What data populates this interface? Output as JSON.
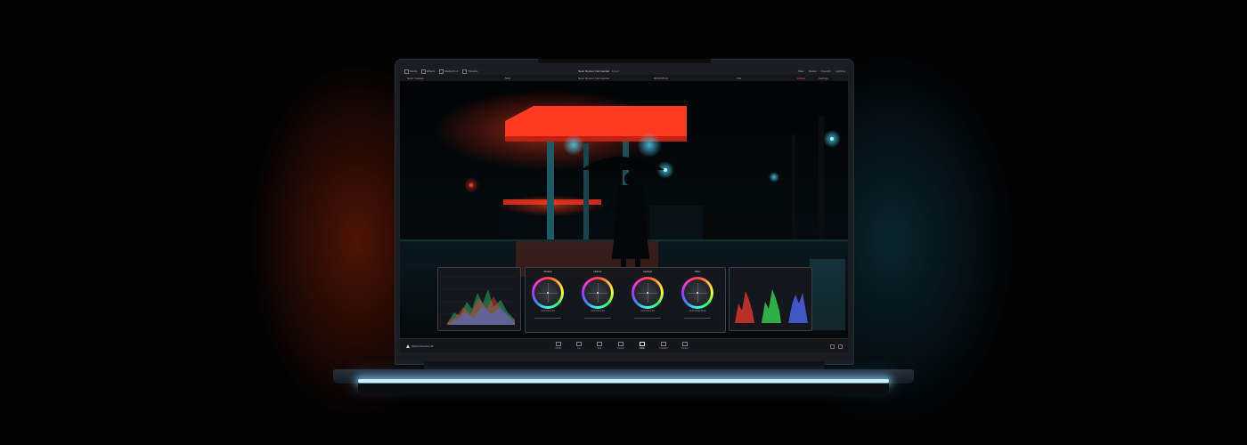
{
  "app": {
    "top_tabs": [
      {
        "label": "Media"
      },
      {
        "label": "Effects"
      },
      {
        "label": "Media Pool"
      },
      {
        "label": "Timeline"
      }
    ],
    "project_title": "Neon Runner Commercial",
    "project_status": "Edited",
    "top_right": [
      {
        "label": "Filter"
      },
      {
        "label": "Nodes"
      },
      {
        "label": "OpenFX"
      },
      {
        "label": "Lightbox"
      }
    ],
    "toolbar": {
      "bin": "Neon Footage",
      "zoom": "54%",
      "timeline_name": "Neon Runner Commercial",
      "timecode": "00:00:05:14",
      "clip": "Clip",
      "library": "Library",
      "settings": "Settings"
    },
    "wheels": [
      {
        "label": "Shadow",
        "values": [
          "0.00",
          "0.00",
          "0.00"
        ]
      },
      {
        "label": "Midtone",
        "values": [
          "0.00",
          "0.00",
          "0.00"
        ]
      },
      {
        "label": "Highlight",
        "values": [
          "0.00",
          "0.00",
          "0.00"
        ]
      },
      {
        "label": "Offset",
        "values": [
          "25.00",
          "25.00",
          "25.00"
        ]
      }
    ],
    "brand": "DaVinci Resolve 18",
    "pages": [
      {
        "label": "Media"
      },
      {
        "label": "Cut"
      },
      {
        "label": "Edit"
      },
      {
        "label": "Fusion"
      },
      {
        "label": "Color"
      },
      {
        "label": "Fairlight"
      },
      {
        "label": "Deliver"
      }
    ],
    "active_page": "Color"
  },
  "colors": {
    "canopy": "#ff3a22",
    "teal_light": "#3fd6ff",
    "ui_dark": "#141619",
    "keyboard_glow": "#cfefff"
  },
  "icons": {
    "page_icons": [
      "media-page-icon",
      "cut-page-icon",
      "edit-page-icon",
      "fusion-page-icon",
      "color-page-icon",
      "fairlight-page-icon",
      "deliver-page-icon"
    ]
  }
}
